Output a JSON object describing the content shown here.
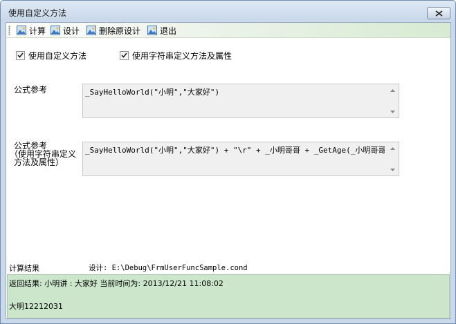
{
  "window": {
    "title": "使用自定义方法"
  },
  "toolbar": {
    "items": [
      {
        "label": "计算"
      },
      {
        "label": "设计"
      },
      {
        "label": "删除原设计"
      },
      {
        "label": "退出"
      }
    ]
  },
  "options": {
    "use_custom_method": {
      "label": "使用自定义方法",
      "checked": true
    },
    "use_string_method": {
      "label": "使用字符串定义方法及属性",
      "checked": true
    }
  },
  "formula1": {
    "label": "公式参考",
    "value": "_SayHelloWorld(\"小明\",\"大家好\")"
  },
  "formula2": {
    "label_line1": "公式参考",
    "label_line2": "（使用字符串定义",
    "label_line3": "方法及属性）",
    "value": "_SayHelloWorld(\"小明\",\"大家好\") + \"\\r\" + _小明哥哥 + _GetAge(_小明哥哥)"
  },
  "status": {
    "result_label": "计算结果",
    "design_path": "设计: E:\\Debug\\FrmUserFuncSample.cond"
  },
  "result": {
    "line1": "返回结果: 小明讲 : 大家好 当前时间为:  2013/12/21 11:08:02",
    "line2": "大明12212031"
  },
  "colors": {
    "result_bg": "#cbe6cb",
    "toolbar_tint": "#d7ead2"
  }
}
